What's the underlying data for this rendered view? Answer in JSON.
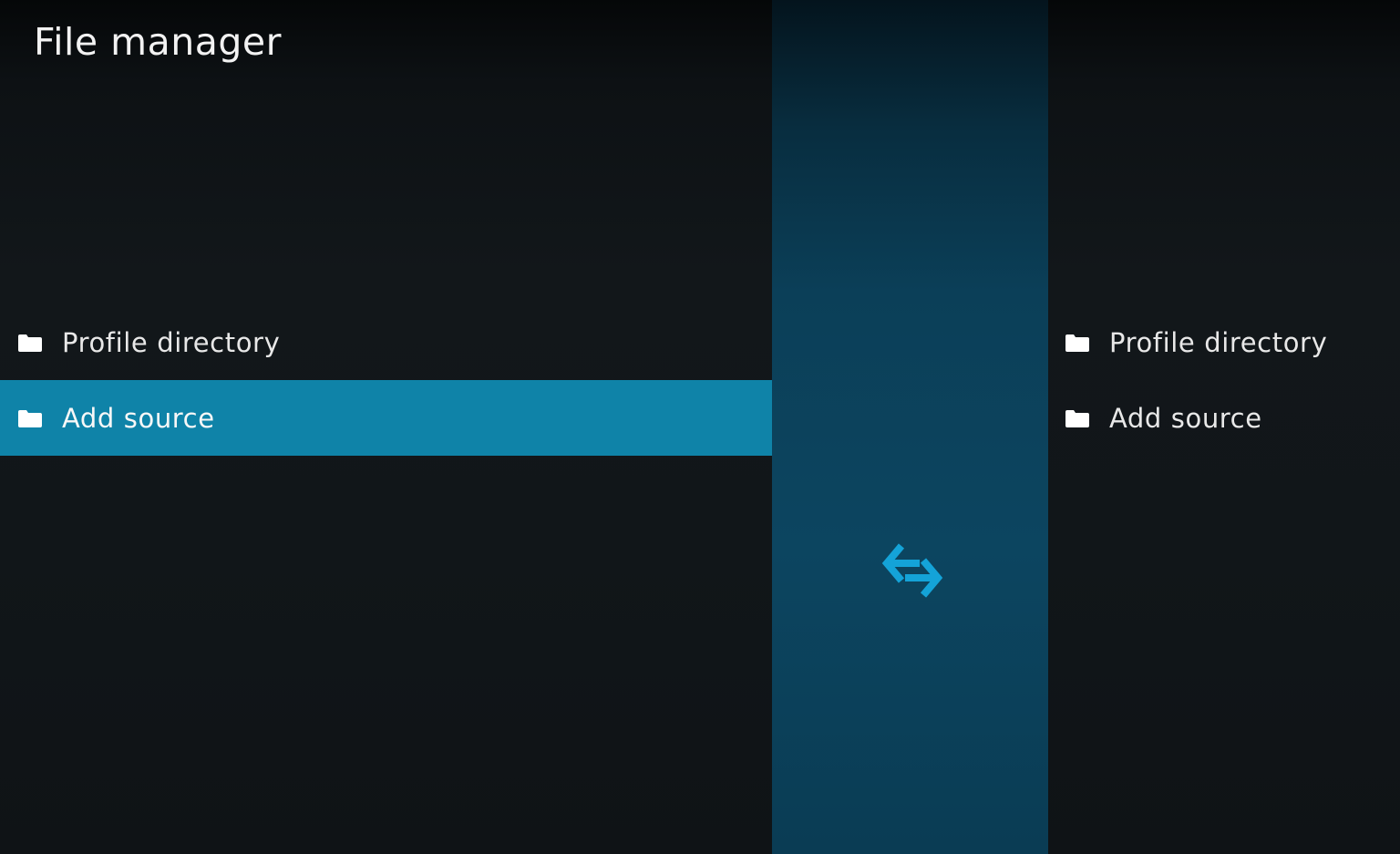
{
  "window": {
    "title": "File manager"
  },
  "left_pane": {
    "items": [
      {
        "label": "Profile directory",
        "icon": "folder-icon",
        "selected": false
      },
      {
        "label": "Add source",
        "icon": "folder-icon",
        "selected": true
      }
    ]
  },
  "right_pane": {
    "items": [
      {
        "label": "Profile directory",
        "icon": "folder-icon",
        "selected": false
      },
      {
        "label": "Add source",
        "icon": "folder-icon",
        "selected": false
      }
    ]
  },
  "divider": {
    "icon": "swap-arrows-icon"
  },
  "colors": {
    "selection": "#0f83a8",
    "accent": "#12a0d7",
    "divider": "#0b4159"
  }
}
